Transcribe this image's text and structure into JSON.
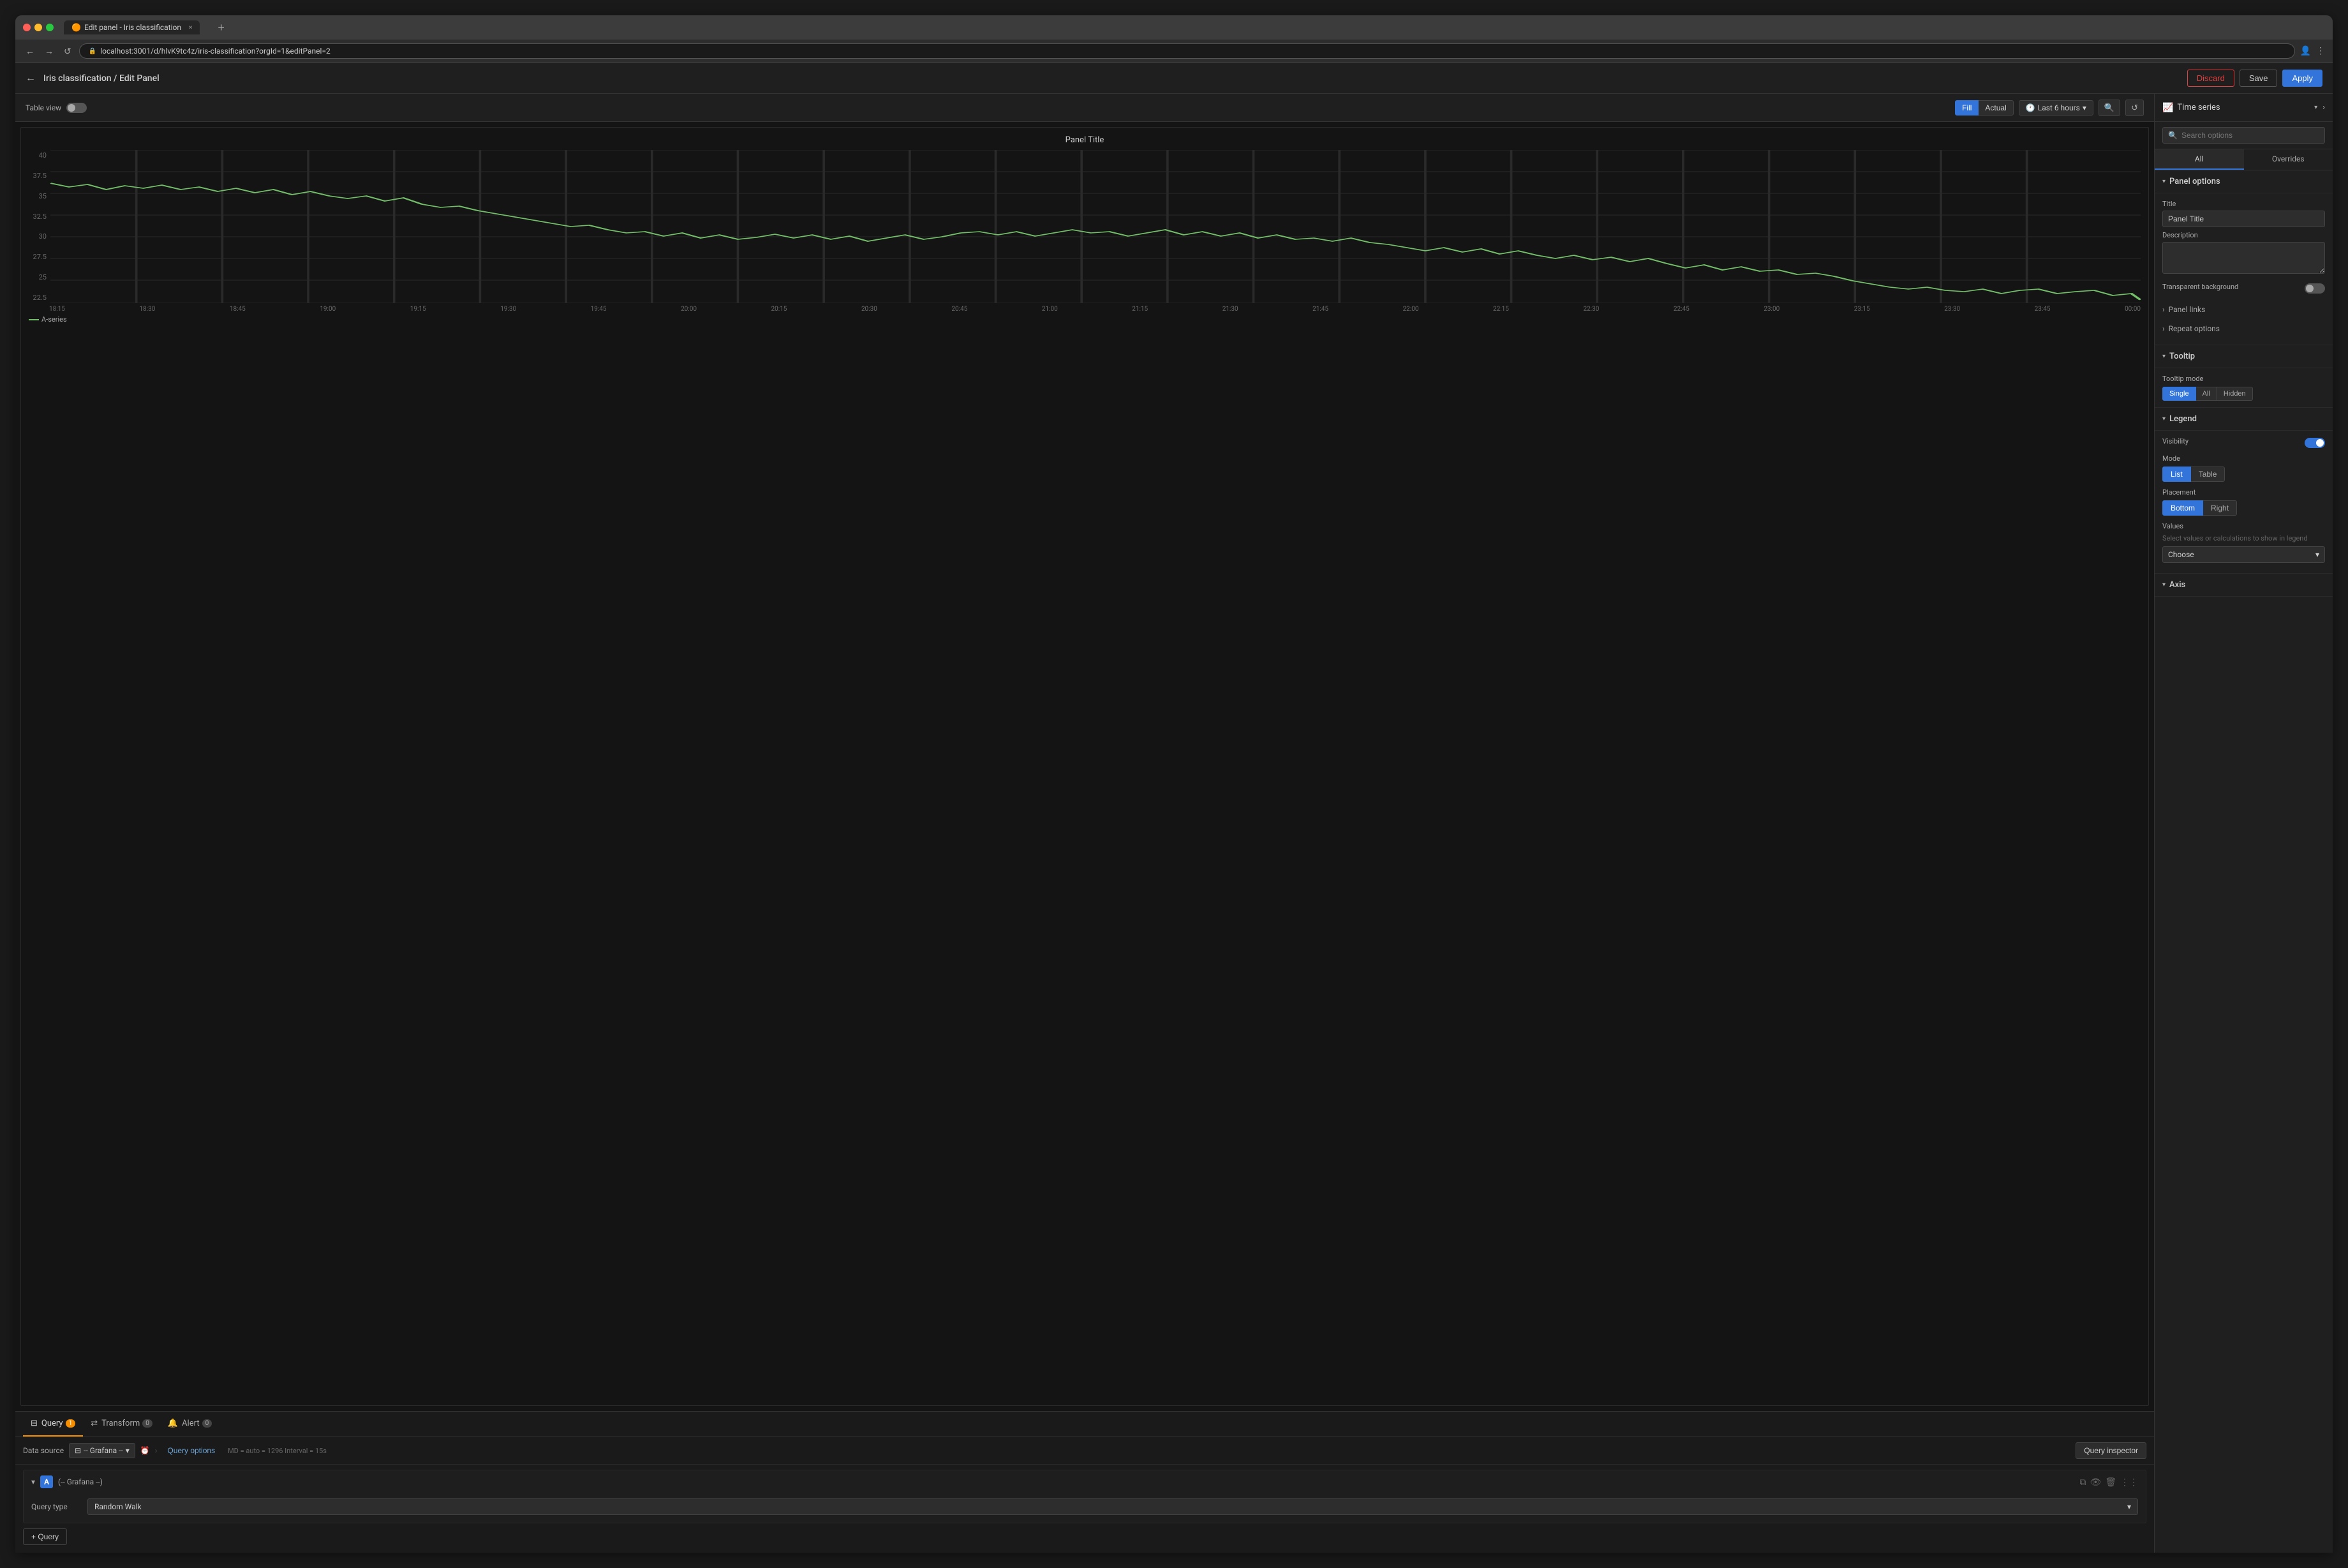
{
  "browser": {
    "url": "localhost:3001/d/hlvK9tc4z/iris-classification?orgId=1&editPanel=2",
    "tab_title": "Edit panel - Iris classification",
    "tab_close": "×",
    "new_tab": "+",
    "nav_back": "←",
    "nav_forward": "→",
    "nav_refresh": "↺"
  },
  "header": {
    "back_btn": "←",
    "breadcrumb": "Iris classification / Edit Panel",
    "btn_discard": "Discard",
    "btn_save": "Save",
    "btn_apply": "Apply"
  },
  "panel_toolbar": {
    "table_view_label": "Table view",
    "fill_btn": "Fill",
    "actual_btn": "Actual",
    "time_range": "Last 6 hours",
    "time_icon": "🕐"
  },
  "viz_selector": {
    "icon": "📈",
    "name": "Time series"
  },
  "chart": {
    "title": "Panel Title",
    "y_labels": [
      "40",
      "37.5",
      "35",
      "32.5",
      "30",
      "27.5",
      "25",
      "22.5"
    ],
    "x_labels": [
      "18:15",
      "18:30",
      "18:45",
      "19:00",
      "19:15",
      "19:30",
      "19:45",
      "20:00",
      "20:15",
      "20:30",
      "20:45",
      "21:00",
      "21:15",
      "21:30",
      "21:45",
      "22:00",
      "22:15",
      "22:30",
      "22:45",
      "23:00",
      "23:15",
      "23:30",
      "23:45",
      "00:00"
    ],
    "legend_label": "A-series",
    "legend_color": "#73bf69"
  },
  "query_area": {
    "tabs": [
      {
        "label": "Query",
        "badge": "1",
        "active": true
      },
      {
        "label": "Transform",
        "badge": "0"
      },
      {
        "label": "Alert",
        "badge": "0"
      }
    ],
    "datasource_label": "Data source",
    "datasource_value": "-- Grafana --",
    "query_options_label": "Query options",
    "query_meta": "MD = auto = 1296   Interval = 15s",
    "query_inspector_btn": "Query inspector",
    "query_row": {
      "letter": "A",
      "datasource_info": "(-- Grafana --)",
      "query_type_label": "Query type",
      "query_type_value": "Random Walk"
    },
    "add_query_btn": "+ Query"
  },
  "right_sidebar": {
    "search_placeholder": "Search options",
    "tabs": [
      "All",
      "Overrides"
    ],
    "sections": {
      "panel_options": {
        "title": "Panel options",
        "title_label": "Title",
        "title_value": "Panel Title",
        "desc_label": "Description",
        "bg_label": "Transparent background",
        "sub_sections": [
          {
            "label": "Panel links"
          },
          {
            "label": "Repeat options"
          }
        ]
      },
      "tooltip": {
        "title": "Tooltip",
        "mode_label": "Tooltip mode",
        "modes": [
          "Single",
          "All",
          "Hidden"
        ]
      },
      "legend": {
        "title": "Legend",
        "visibility_label": "Visibility",
        "mode_label": "Mode",
        "mode_opts": [
          "List",
          "Table"
        ],
        "placement_label": "Placement",
        "placement_opts": [
          "Bottom",
          "Right"
        ],
        "values_label": "Values",
        "values_helper": "Select values or calculations to show in legend",
        "values_placeholder": "Choose"
      },
      "axis": {
        "title": "Axis"
      }
    }
  }
}
